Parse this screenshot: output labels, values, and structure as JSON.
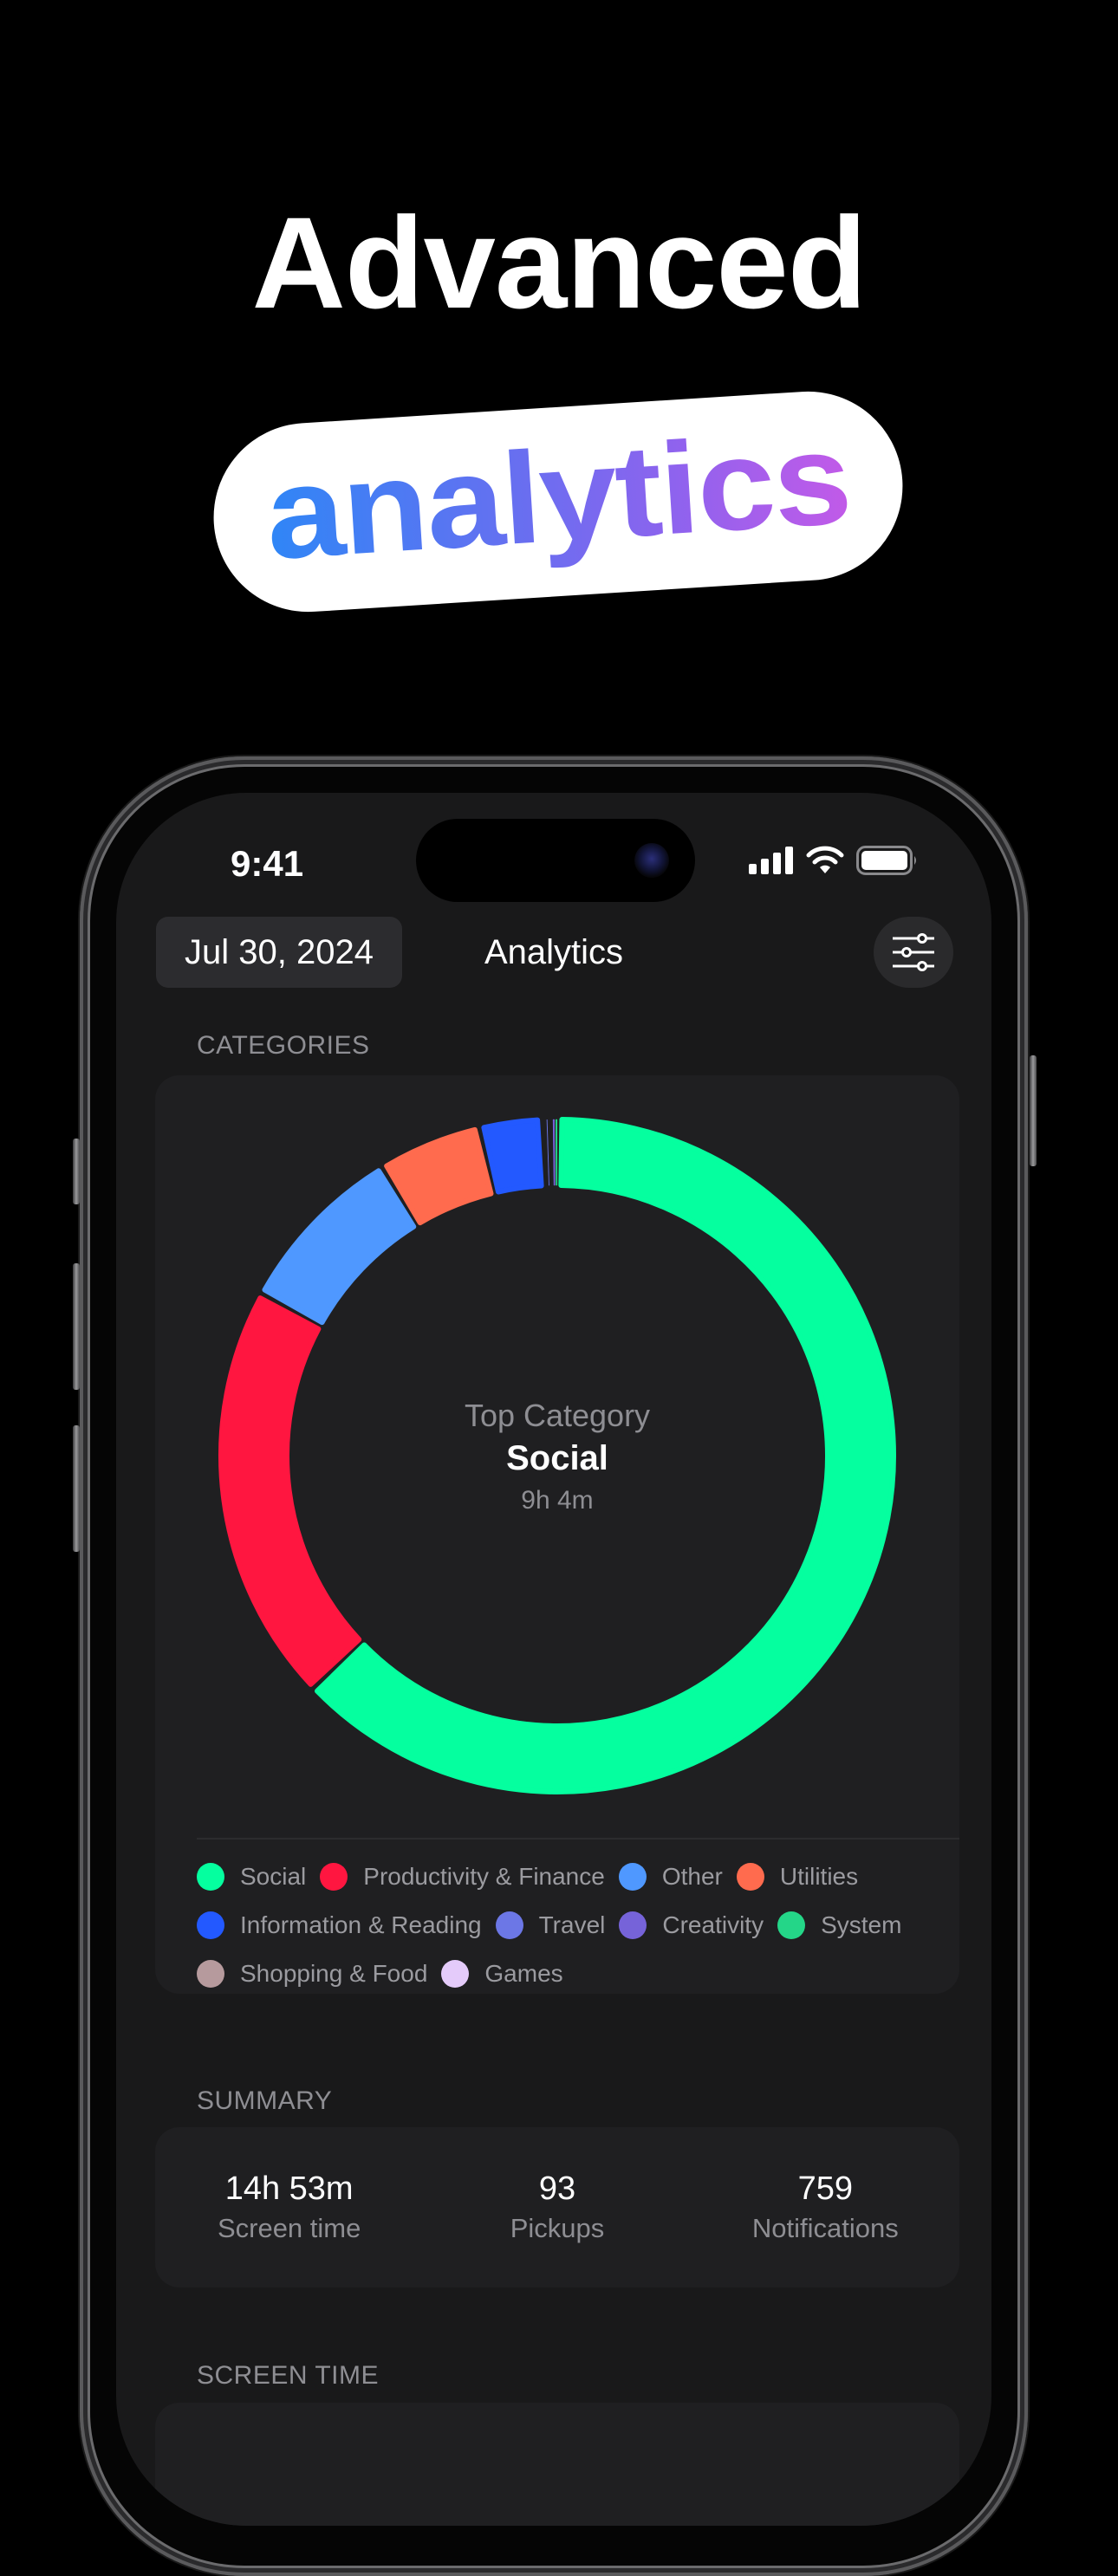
{
  "promo": {
    "headline": "Advanced",
    "highlight": "analytics"
  },
  "status_bar": {
    "time": "9:41",
    "icons": [
      "cellular-signal-icon",
      "wifi-icon",
      "battery-icon"
    ]
  },
  "nav": {
    "date": "Jul 30, 2024",
    "title": "Analytics",
    "filter_icon": "sliders-icon"
  },
  "categories": {
    "section_label": "CATEGORIES",
    "center": {
      "label": "Top Category",
      "value": "Social",
      "duration": "9h 4m"
    }
  },
  "summary": {
    "section_label": "SUMMARY",
    "stats": [
      {
        "value": "14h 53m",
        "label": "Screen time"
      },
      {
        "value": "93",
        "label": "Pickups"
      },
      {
        "value": "759",
        "label": "Notifications"
      }
    ]
  },
  "screen_time": {
    "section_label": "SCREEN TIME"
  },
  "chart_data": {
    "type": "pie",
    "variant": "donut",
    "title": "Categories",
    "center_label": "Top Category",
    "center_value": "Social",
    "center_sub": "9h 4m",
    "unit": "minutes (estimated from arc length)",
    "legend_position": "bottom",
    "series": [
      {
        "name": "Social",
        "value": 544,
        "color": "#05FF9F"
      },
      {
        "name": "Productivity & Finance",
        "value": 174,
        "color": "#FF1640"
      },
      {
        "name": "Other",
        "value": 72,
        "color": "#4F98FF"
      },
      {
        "name": "Utilities",
        "value": 43,
        "color": "#FF6B4E"
      },
      {
        "name": "Information & Reading",
        "value": 26,
        "color": "#2359FF"
      },
      {
        "name": "Travel",
        "value": 4,
        "color": "#6C77E6"
      },
      {
        "name": "Creativity",
        "value": 1.5,
        "color": "#7663D9"
      },
      {
        "name": "System",
        "value": 0.7,
        "color": "#24D688"
      },
      {
        "name": "Shopping & Food",
        "value": 0,
        "color": "#B69A9D"
      },
      {
        "name": "Games",
        "value": 0,
        "color": "#E4CBFA"
      }
    ]
  }
}
